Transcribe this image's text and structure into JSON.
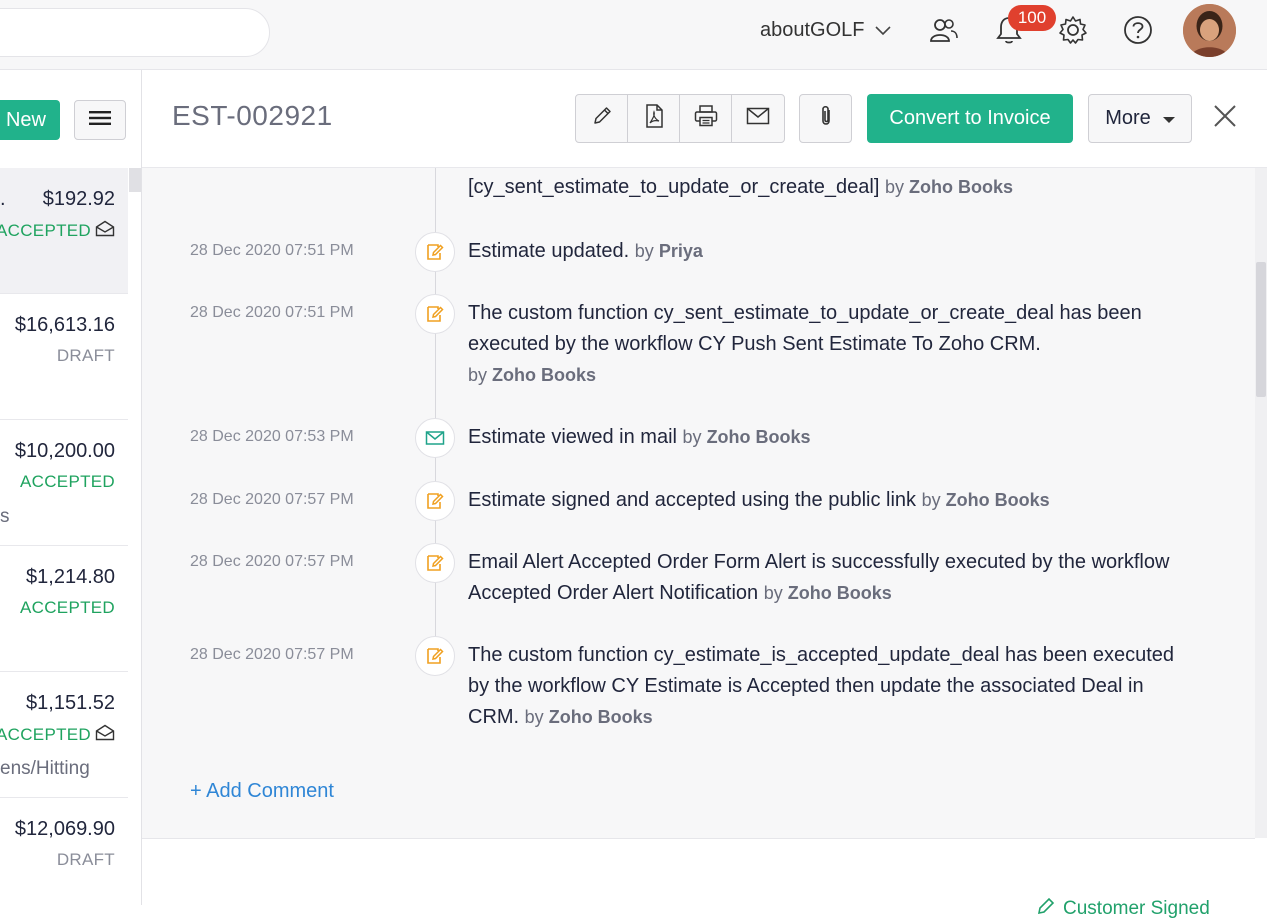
{
  "topbar": {
    "org_name": "aboutGOLF",
    "notification_count": "100"
  },
  "sidebar": {
    "new_label": "New",
    "rows": [
      {
        "prefix": ".",
        "amount": "$192.92",
        "status": "ACCEPTED",
        "status_color": "#1fa35f",
        "mail": true,
        "extra": "",
        "selected": true
      },
      {
        "prefix": "",
        "amount": "$16,613.16",
        "status": "DRAFT",
        "status_color": "#8a8d99",
        "mail": false,
        "extra": "",
        "selected": false
      },
      {
        "prefix": "",
        "amount": "$10,200.00",
        "status": "ACCEPTED",
        "status_color": "#1fa35f",
        "mail": false,
        "extra": "s",
        "selected": false
      },
      {
        "prefix": "",
        "amount": "$1,214.80",
        "status": "ACCEPTED",
        "status_color": "#1fa35f",
        "mail": false,
        "extra": "",
        "selected": false
      },
      {
        "prefix": "",
        "amount": "$1,151.52",
        "status": "ACCEPTED",
        "status_color": "#1fa35f",
        "mail": true,
        "extra": "ens/Hitting",
        "selected": false
      },
      {
        "prefix": "",
        "amount": "$12,069.90",
        "status": "DRAFT",
        "status_color": "#8a8d99",
        "mail": false,
        "extra": "",
        "selected": false
      }
    ]
  },
  "detail": {
    "estimate_number": "EST-002921",
    "convert_label": "Convert to Invoice",
    "more_label": "More",
    "icons": [
      "edit-icon",
      "pdf-icon",
      "print-icon",
      "mail-icon"
    ]
  },
  "history": {
    "entries": [
      {
        "date": "",
        "icon": "none",
        "text": "[cy_sent_estimate_to_update_or_create_deal]",
        "by": "Zoho Books"
      },
      {
        "date": "28 Dec 2020 07:51 PM",
        "icon": "edit",
        "text": "Estimate updated.",
        "by": "Priya"
      },
      {
        "date": "28 Dec 2020 07:51 PM",
        "icon": "edit",
        "text": "The custom function cy_sent_estimate_to_update_or_create_deal has been executed by the workflow CY Push Sent Estimate To Zoho CRM.",
        "by": "Zoho Books"
      },
      {
        "date": "28 Dec 2020 07:53 PM",
        "icon": "mail",
        "text": "Estimate viewed in mail",
        "by": "Zoho Books"
      },
      {
        "date": "28 Dec 2020 07:57 PM",
        "icon": "edit",
        "text": "Estimate signed and accepted using the public link",
        "by": "Zoho Books"
      },
      {
        "date": "28 Dec 2020 07:57 PM",
        "icon": "edit",
        "text": "Email Alert Accepted Order Form Alert is successfully executed by the workflow Accepted Order Alert Notification",
        "by": "Zoho Books"
      },
      {
        "date": "28 Dec 2020 07:57 PM",
        "icon": "edit",
        "text": "The custom function cy_estimate_is_accepted_update_deal has been executed by the workflow CY Estimate is Accepted then update the associated Deal in CRM.",
        "by": "Zoho Books"
      }
    ],
    "by_prefix": "by",
    "add_comment": "+ Add Comment"
  },
  "footer": {
    "customer_signed": "Customer Signed"
  },
  "colors": {
    "accent_green": "#21b28b",
    "link_blue": "#2f86d6",
    "edit_icon_orange": "#f0a020",
    "mail_icon_teal": "#1fa38a"
  }
}
